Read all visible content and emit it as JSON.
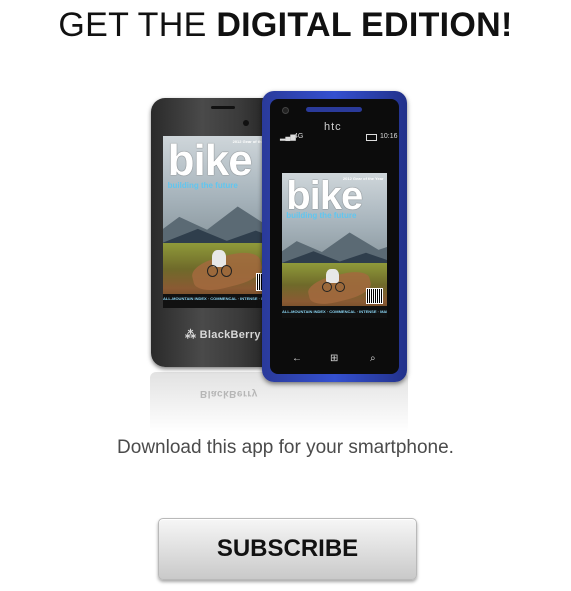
{
  "header": {
    "prefix": "GET THE",
    "emphasis": "DIGITAL EDITION!"
  },
  "devices": {
    "blackberry": {
      "brand": "BlackBerry"
    },
    "htc": {
      "brand": "htc",
      "status_network": "4G",
      "status_time": "10:16"
    },
    "magazine": {
      "title": "bike",
      "issue": "2012 Gear of the Year",
      "cover_line": "building the future",
      "footer_text": "ALL-MOUNTAIN INDEX · COMMENCAL · INTENSE · MAIDEN · NUKEPROOF"
    },
    "reflection_brand": "BlackBerry"
  },
  "tagline": "Download this app for your smartphone.",
  "cta": {
    "label": "SUBSCRIBE"
  },
  "colors": {
    "htc_body": "#3450d0",
    "blackberry_body": "#3a3a3a",
    "magazine_accent": "#5fc6f0"
  }
}
